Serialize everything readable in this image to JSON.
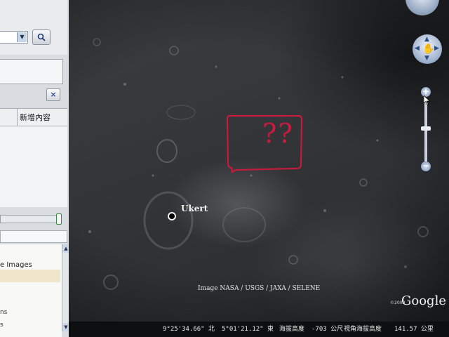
{
  "sidebar": {
    "search_icon": "magnifier-icon",
    "close_label": "×",
    "tab_label": "新增內容",
    "layers": {
      "item1": "e Images",
      "item2": "ns",
      "item3": "s"
    }
  },
  "map": {
    "place_label": "Ukert",
    "annotation_text": "??",
    "annotation_color": "#d01a3c",
    "credit": "Image NASA / USGS / JAXA / SELENE",
    "logo_prefix": "©2009",
    "logo": "Google",
    "zoom_in": "+",
    "zoom_out": "−"
  },
  "status": {
    "lat": "9°25'34.66\" 北",
    "lon": "5°01'21.12\" 東",
    "elev_label": "海拔高度",
    "elev_value": "-703 公尺",
    "eye_label": "視角海拔高度",
    "eye_value": "141.57 公里"
  }
}
